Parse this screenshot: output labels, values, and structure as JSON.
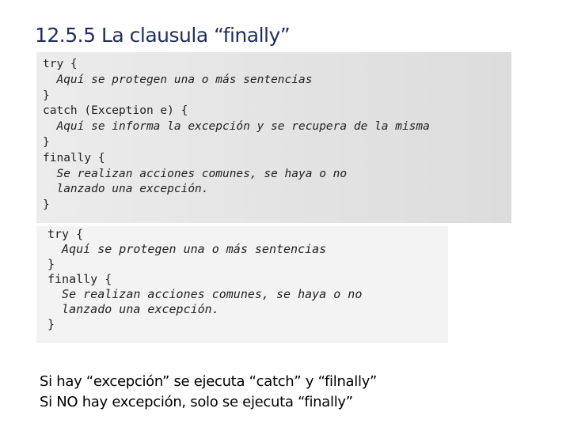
{
  "title": "12.5.5 La clausula “finally”",
  "code_block_1": [
    {
      "text": "try {",
      "italic": false
    },
    {
      "text": "  Aquí se protegen una o más sentencias",
      "italic": true
    },
    {
      "text": "}",
      "italic": false
    },
    {
      "text": "catch (Exception e) {",
      "italic": false
    },
    {
      "text": "  Aquí se informa la excepción y se recupera de la misma",
      "italic": true
    },
    {
      "text": "}",
      "italic": false
    },
    {
      "text": "finally {",
      "italic": false
    },
    {
      "text": "  Se realizan acciones comunes, se haya o no",
      "italic": true
    },
    {
      "text": "  lanzado una excepción.",
      "italic": true
    },
    {
      "text": "}",
      "italic": false
    }
  ],
  "code_block_2": [
    {
      "text": "try {",
      "italic": false
    },
    {
      "text": "  Aquí se protegen una o más sentencias",
      "italic": true
    },
    {
      "text": "}",
      "italic": false
    },
    {
      "text": "finally {",
      "italic": false
    },
    {
      "text": "  Se realizan acciones comunes, se haya o no",
      "italic": true
    },
    {
      "text": "  lanzado una excepción.",
      "italic": true
    },
    {
      "text": "}",
      "italic": false
    }
  ],
  "notes": [
    "Si hay “excepción” se ejecuta “catch” y “filnally”",
    "Si NO hay excepción, solo se ejecuta “finally”"
  ]
}
